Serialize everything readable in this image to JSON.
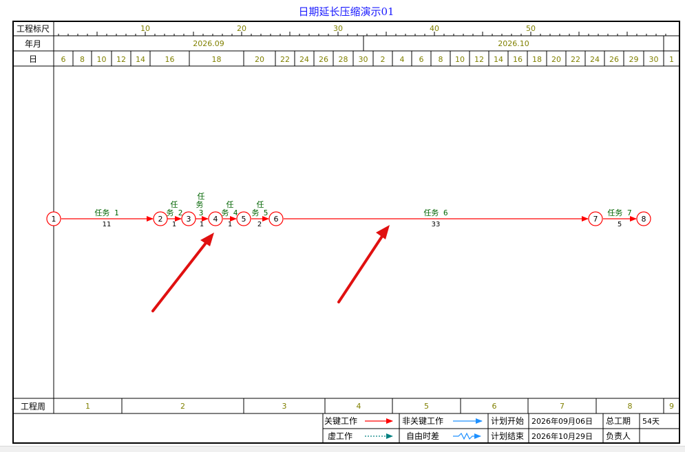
{
  "title": "日期延长压缩演示01",
  "row_labels": {
    "scale": "工程标尺",
    "month": "年月",
    "day": "日",
    "week": "工程周"
  },
  "scale_ticks": [
    "10",
    "20",
    "30",
    "40",
    "50"
  ],
  "months": [
    "2026.09",
    "2026.10"
  ],
  "days": [
    "6",
    "8",
    "10",
    "12",
    "14",
    "16",
    "18",
    "20",
    "22",
    "24",
    "26",
    "28",
    "30",
    "2",
    "4",
    "6",
    "8",
    "10",
    "12",
    "14",
    "16",
    "18",
    "20",
    "22",
    "24",
    "26",
    "29",
    "30",
    "1"
  ],
  "weeks": [
    "1",
    "2",
    "3",
    "4",
    "5",
    "6",
    "7",
    "8",
    "9"
  ],
  "nodes": [
    "1",
    "2",
    "3",
    "4",
    "5",
    "6",
    "7",
    "8"
  ],
  "tasks": [
    {
      "label": "任务 1",
      "duration": "11"
    },
    {
      "label": "任务 2",
      "duration": "1"
    },
    {
      "label": "任务 3",
      "duration": "1"
    },
    {
      "label": "任务 4",
      "duration": "1"
    },
    {
      "label": "任务 5",
      "duration": "2"
    },
    {
      "label": "任务 6",
      "duration": "33"
    },
    {
      "label": "任务 7",
      "duration": "5"
    }
  ],
  "legend": {
    "critical": "关键工作",
    "noncritical": "非关键工作",
    "dummy": "虚工作",
    "float": "自由时差",
    "plan_start_label": "计划开始",
    "plan_start_value": "2026年09月06日",
    "plan_end_label": "计划结束",
    "plan_end_value": "2026年10月29日",
    "total_label": "总工期",
    "total_value": "54天",
    "owner_label": "负责人",
    "owner_value": ""
  },
  "colors": {
    "title": "#1a1aff",
    "axis_text": "#808000",
    "task_label": "#006400",
    "critical": "#ff0000",
    "noncritical": "#1e90ff",
    "dummy": "#008080",
    "annotation": "#e01010"
  }
}
